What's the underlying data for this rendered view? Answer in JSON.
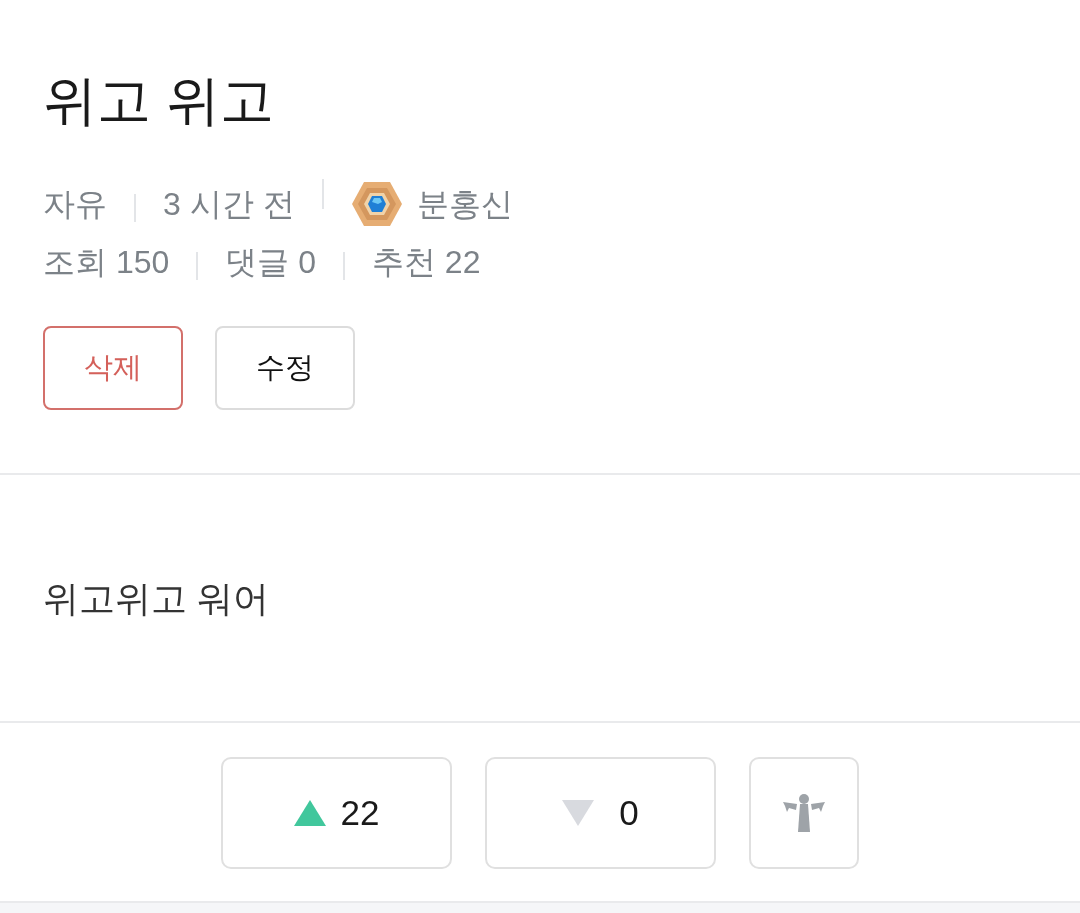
{
  "post": {
    "title": "위고 위고",
    "category": "자유",
    "time": "3 시간 전",
    "author": {
      "name": "분홍신"
    },
    "stats": [
      {
        "label": "조회 150"
      },
      {
        "label": "댓글 0"
      },
      {
        "label": "추천 22"
      }
    ]
  },
  "actions": [
    {
      "label": "삭제",
      "kind": "danger"
    },
    {
      "label": "수정",
      "kind": "default"
    }
  ],
  "body": "위고위고 워어",
  "votes": [
    {
      "kind": "up",
      "count": "22"
    },
    {
      "kind": "down",
      "count": "0"
    },
    {
      "kind": "report"
    }
  ]
}
